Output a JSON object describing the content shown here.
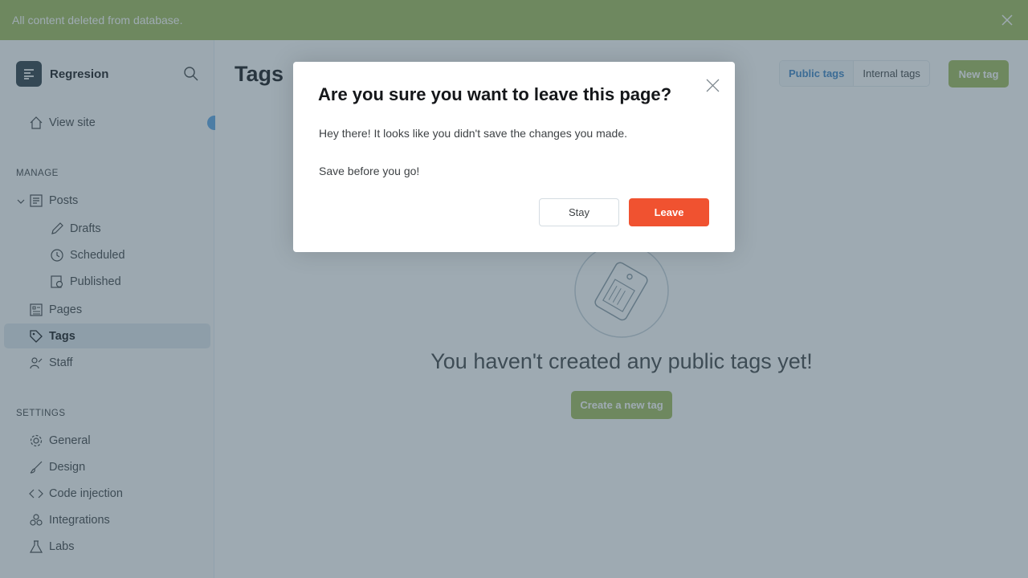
{
  "notification": {
    "text": "All content deleted from database."
  },
  "sidebar": {
    "brand": "Regresion",
    "view_site": "View site",
    "manage_label": "MANAGE",
    "settings_label": "SETTINGS",
    "posts": "Posts",
    "drafts": "Drafts",
    "scheduled": "Scheduled",
    "published": "Published",
    "pages": "Pages",
    "tags": "Tags",
    "staff": "Staff",
    "general": "General",
    "design": "Design",
    "code_injection": "Code injection",
    "integrations": "Integrations",
    "labs": "Labs"
  },
  "main": {
    "title": "Tags",
    "tab_public": "Public tags",
    "tab_internal": "Internal tags",
    "new_tag": "New tag",
    "empty_text": "You haven't created any public tags yet!",
    "create_button": "Create a new tag"
  },
  "modal": {
    "title": "Are you sure you want to leave this page?",
    "body_1": "Hey there! It looks like you didn't save the changes you made.",
    "body_2": "Save before you go!",
    "stay": "Stay",
    "leave": "Leave"
  },
  "colors": {
    "accent_green": "#9fbb58",
    "danger_red": "#f05230",
    "link_blue": "#3a82c4"
  }
}
